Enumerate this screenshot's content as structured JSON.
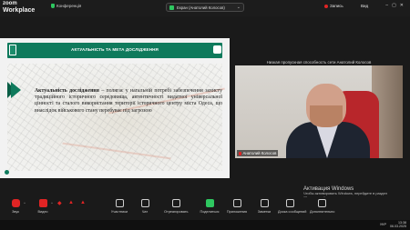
{
  "app": {
    "brand_line1": "zoom",
    "brand_line2": "Workplace"
  },
  "topbar": {
    "conference_label": "Конференція",
    "screen_share_label": "Екран (Анатолий Колосов)",
    "record_label": "Запись",
    "view_label": "Вид"
  },
  "slide": {
    "title": "АКТУАЛЬНІСТЬ ТА МЕТА ДОСЛІДЖЕННЯ",
    "body_bold": "Актуальність дослідження",
    "body_rest": " – полягає у нагальній потребі забезпечення захисту традиційного історичного середовища, автентичності видатної універсальної цінності та сталого використання території історичного центру міста Одеса, що внаслідок військового стану перебуває під загрозою",
    "accent_color": "#0f7a5c"
  },
  "participant": {
    "connection_notice": "Низкая пропускная способность сети Анатолий Колосов",
    "name": "Анатолий Колосов"
  },
  "toolbar": {
    "items": [
      {
        "label": "Звук"
      },
      {
        "label": "Видео"
      },
      {
        "label": "Участники"
      },
      {
        "label": "Чат"
      },
      {
        "label": "Отреагировать"
      },
      {
        "label": "Поделиться"
      },
      {
        "label": "Приложения"
      },
      {
        "label": "Заметки"
      },
      {
        "label": "Доска сообщений"
      },
      {
        "label": "Дополнительно"
      }
    ]
  },
  "activation": {
    "title": "Активация Windows",
    "subtitle": "Чтобы активировать Windows, перейдите в раздел \"Параметры\"."
  },
  "system": {
    "language": "УКР",
    "time": "13:38",
    "date": "06.03.2025"
  }
}
